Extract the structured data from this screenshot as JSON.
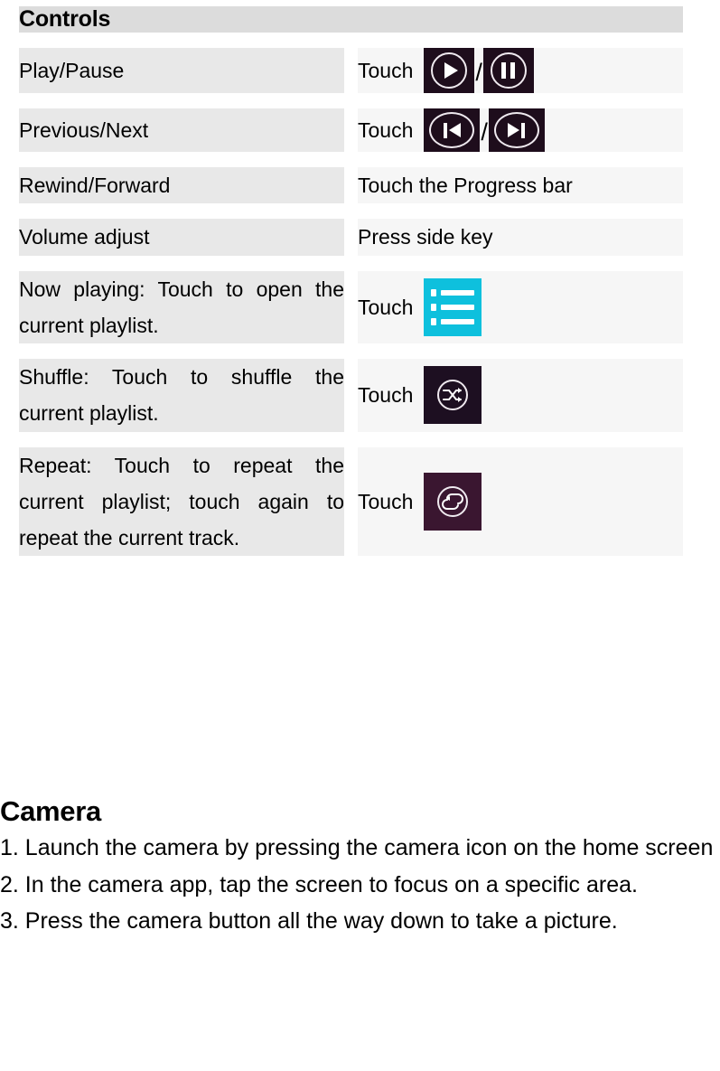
{
  "table": {
    "header": "Controls",
    "rows": [
      {
        "action": "Play/Pause",
        "instruction_label": "Touch",
        "icons": [
          "play-icon",
          "pause-icon"
        ],
        "separator": "/"
      },
      {
        "action": "Previous/Next",
        "instruction_label": "Touch",
        "icons": [
          "previous-track-icon",
          "next-track-icon"
        ],
        "separator": "/"
      },
      {
        "action": "Rewind/Forward",
        "instruction_text": "Touch the Progress bar"
      },
      {
        "action": "Volume adjust",
        "instruction_text": "Press side key"
      },
      {
        "action": "Now playing: Touch to open the current playlist.",
        "instruction_label": "Touch",
        "icons": [
          "playlist-icon"
        ]
      },
      {
        "action": "Shuffle: Touch to shuffle the current playlist.",
        "instruction_label": "Touch",
        "icons": [
          "shuffle-icon"
        ]
      },
      {
        "action": "Repeat: Touch to repeat the current playlist; touch again to repeat the current track.",
        "instruction_label": "Touch",
        "icons": [
          "repeat-icon"
        ]
      }
    ]
  },
  "camera": {
    "title": "Camera",
    "steps": [
      "1. Launch the camera by pressing the camera icon on the home screen",
      "2. In the camera app, tap the screen to focus on a specific area.",
      "3. Press the camera button all the way down to take a picture."
    ]
  },
  "colors": {
    "header_bg": "#dcdcdc",
    "left_cell_bg": "#e8e8e8",
    "right_cell_bg": "#f6f6f6",
    "playlist_accent": "#0ec0dd",
    "media_dark": "#1e0d1c",
    "repeat_plum": "#3a1630",
    "text": "#000000"
  }
}
